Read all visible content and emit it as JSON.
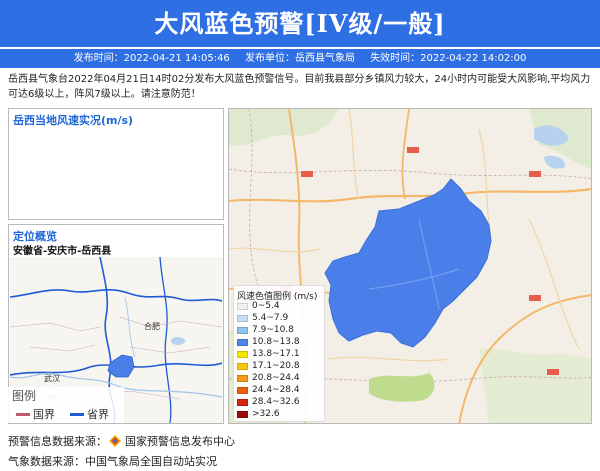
{
  "banner": {
    "title": "大风蓝色预警[IV级/一般]"
  },
  "meta": {
    "issue_time_label": "发布时间：2022-04-21 14:05:46",
    "issuer_label": "发布单位：岳西县气象局",
    "expire_label": "失效时间：2022-04-22 14:02:00"
  },
  "description": "岳西县气象台2022年04月21日14时02分发布大风蓝色预警信号。目前我县部分乡镇风力较大，24小时内可能受大风影响,平均风力可达6级以上，阵风7级以上。请注意防范！",
  "wind_panel": {
    "title": "岳西当地风速实况(m/s)"
  },
  "location_panel": {
    "title": "定位概览",
    "subtitle": "安徽省-安庆市-岳西县",
    "map_labels": {
      "hefei": "合肥",
      "wuhan": "武汉"
    }
  },
  "mini_legend": {
    "title": "图例",
    "items": [
      {
        "label": "国界",
        "color": "#c05a73"
      },
      {
        "label": "省界",
        "color": "#1f5bd6"
      }
    ]
  },
  "color_legend": {
    "title": "风速色值图例 (m/s)",
    "items": [
      {
        "label": "0~5.4",
        "color": "#f2f2f2"
      },
      {
        "label": "5.4~7.9",
        "color": "#c5ddf5"
      },
      {
        "label": "7.9~10.8",
        "color": "#8cc4ef"
      },
      {
        "label": "10.8~13.8",
        "color": "#4e86ea"
      },
      {
        "label": "13.8~17.1",
        "color": "#f2e600"
      },
      {
        "label": "17.1~20.8",
        "color": "#f7c60e"
      },
      {
        "label": "20.8~24.4",
        "color": "#f59a12"
      },
      {
        "label": "24.4~28.4",
        "color": "#ee6010"
      },
      {
        "label": "28.4~32.6",
        "color": "#d8230d"
      },
      {
        "label": ">32.6",
        "color": "#9c0a0a"
      }
    ]
  },
  "footer": {
    "warning_source": "预警信息数据来源：",
    "warning_source_name": "国家预警信息发布中心",
    "weather_source": "气象数据来源：中国气象局全国自动站实况"
  },
  "colors": {
    "banner_bg": "#2f6fe4",
    "panel_title": "#1f67d6",
    "warning_area": "#4a7fea",
    "map_bg": "#f3efe6"
  }
}
